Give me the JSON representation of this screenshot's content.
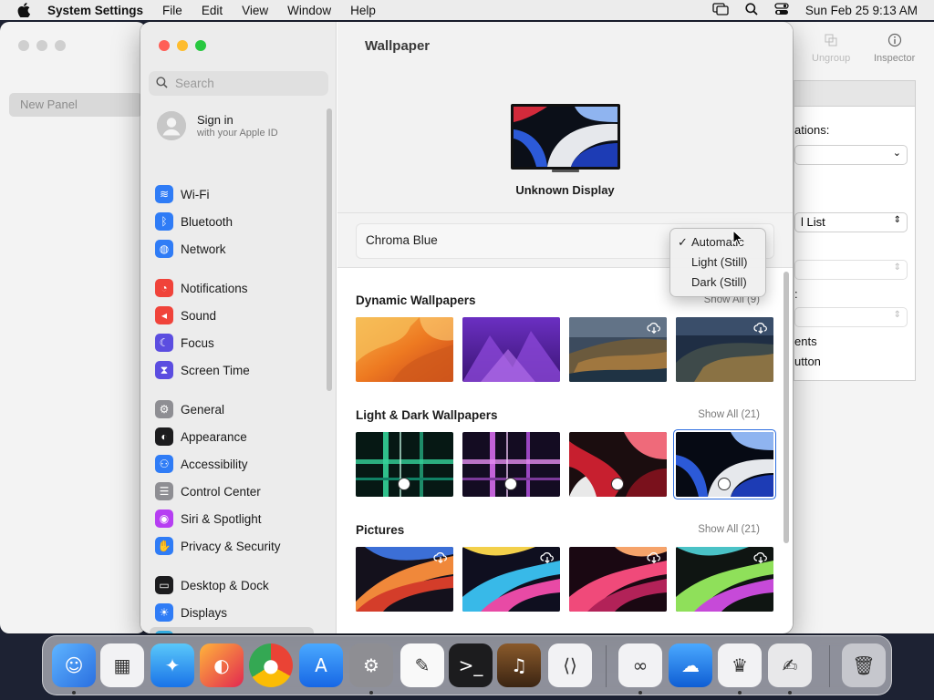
{
  "menubar": {
    "app": "System Settings",
    "items": [
      "File",
      "Edit",
      "View",
      "Window",
      "Help"
    ],
    "clock": "Sun Feb 25  9:13 AM"
  },
  "bg_left": {
    "panel_item": "New Panel"
  },
  "bg_right": {
    "toolbar": {
      "ungroup": "Ungroup",
      "inspector": "Inspector"
    },
    "label_1": "ations:",
    "select_2": "l List",
    "label_3": ":",
    "label_4": "ents",
    "label_5": "utton"
  },
  "sidebar": {
    "search_placeholder": "Search",
    "account": {
      "title": "Sign in",
      "subtitle": "with your Apple ID"
    },
    "items": [
      {
        "label": "Wi-Fi",
        "icon": "wifi-icon",
        "color": "#2f7cf6"
      },
      {
        "label": "Bluetooth",
        "icon": "bluetooth-icon",
        "color": "#2f7cf6"
      },
      {
        "label": "Network",
        "icon": "globe-icon",
        "color": "#2f7cf6"
      },
      {
        "label": "Notifications",
        "icon": "bell-icon",
        "color": "#f0433a"
      },
      {
        "label": "Sound",
        "icon": "speaker-icon",
        "color": "#f0433a"
      },
      {
        "label": "Focus",
        "icon": "moon-icon",
        "color": "#5b4de0"
      },
      {
        "label": "Screen Time",
        "icon": "hourglass-icon",
        "color": "#5b4de0"
      },
      {
        "label": "General",
        "icon": "gear-icon",
        "color": "#8e8e93"
      },
      {
        "label": "Appearance",
        "icon": "appearance-icon",
        "color": "#1c1c1e"
      },
      {
        "label": "Accessibility",
        "icon": "accessibility-icon",
        "color": "#2f7cf6"
      },
      {
        "label": "Control Center",
        "icon": "toggles-icon",
        "color": "#8e8e93"
      },
      {
        "label": "Siri & Spotlight",
        "icon": "siri-icon",
        "color": "#b63ef2"
      },
      {
        "label": "Privacy & Security",
        "icon": "hand-icon",
        "color": "#2f7cf6"
      },
      {
        "label": "Desktop & Dock",
        "icon": "dock-icon",
        "color": "#1c1c1e"
      },
      {
        "label": "Displays",
        "icon": "sun-icon",
        "color": "#2f7cf6"
      },
      {
        "label": "Wallpaper",
        "icon": "wallpaper-icon",
        "color": "#34aadc"
      }
    ]
  },
  "content": {
    "title": "Wallpaper",
    "display_name": "Unknown Display",
    "current_wallpaper": "Chroma Blue",
    "sections": [
      {
        "title": "Dynamic Wallpapers",
        "show_all": "Show All (9)"
      },
      {
        "title": "Light & Dark Wallpapers",
        "show_all": "Show All (21)"
      },
      {
        "title": "Pictures",
        "show_all": "Show All (21)"
      }
    ]
  },
  "appearance_menu": {
    "options": [
      "Automatic",
      "Light (Still)",
      "Dark (Still)"
    ],
    "selected": "Automatic"
  },
  "dock": {
    "apps": [
      "Finder",
      "Launchpad",
      "Safari",
      "Firefox",
      "Chrome",
      "App Store",
      "System Settings",
      "TextEdit",
      "Terminal",
      "Instruments",
      "Visual Studio Code",
      "Visual Studio",
      "OneDrive",
      "Bartender",
      "Script Editor",
      "Trash"
    ]
  }
}
